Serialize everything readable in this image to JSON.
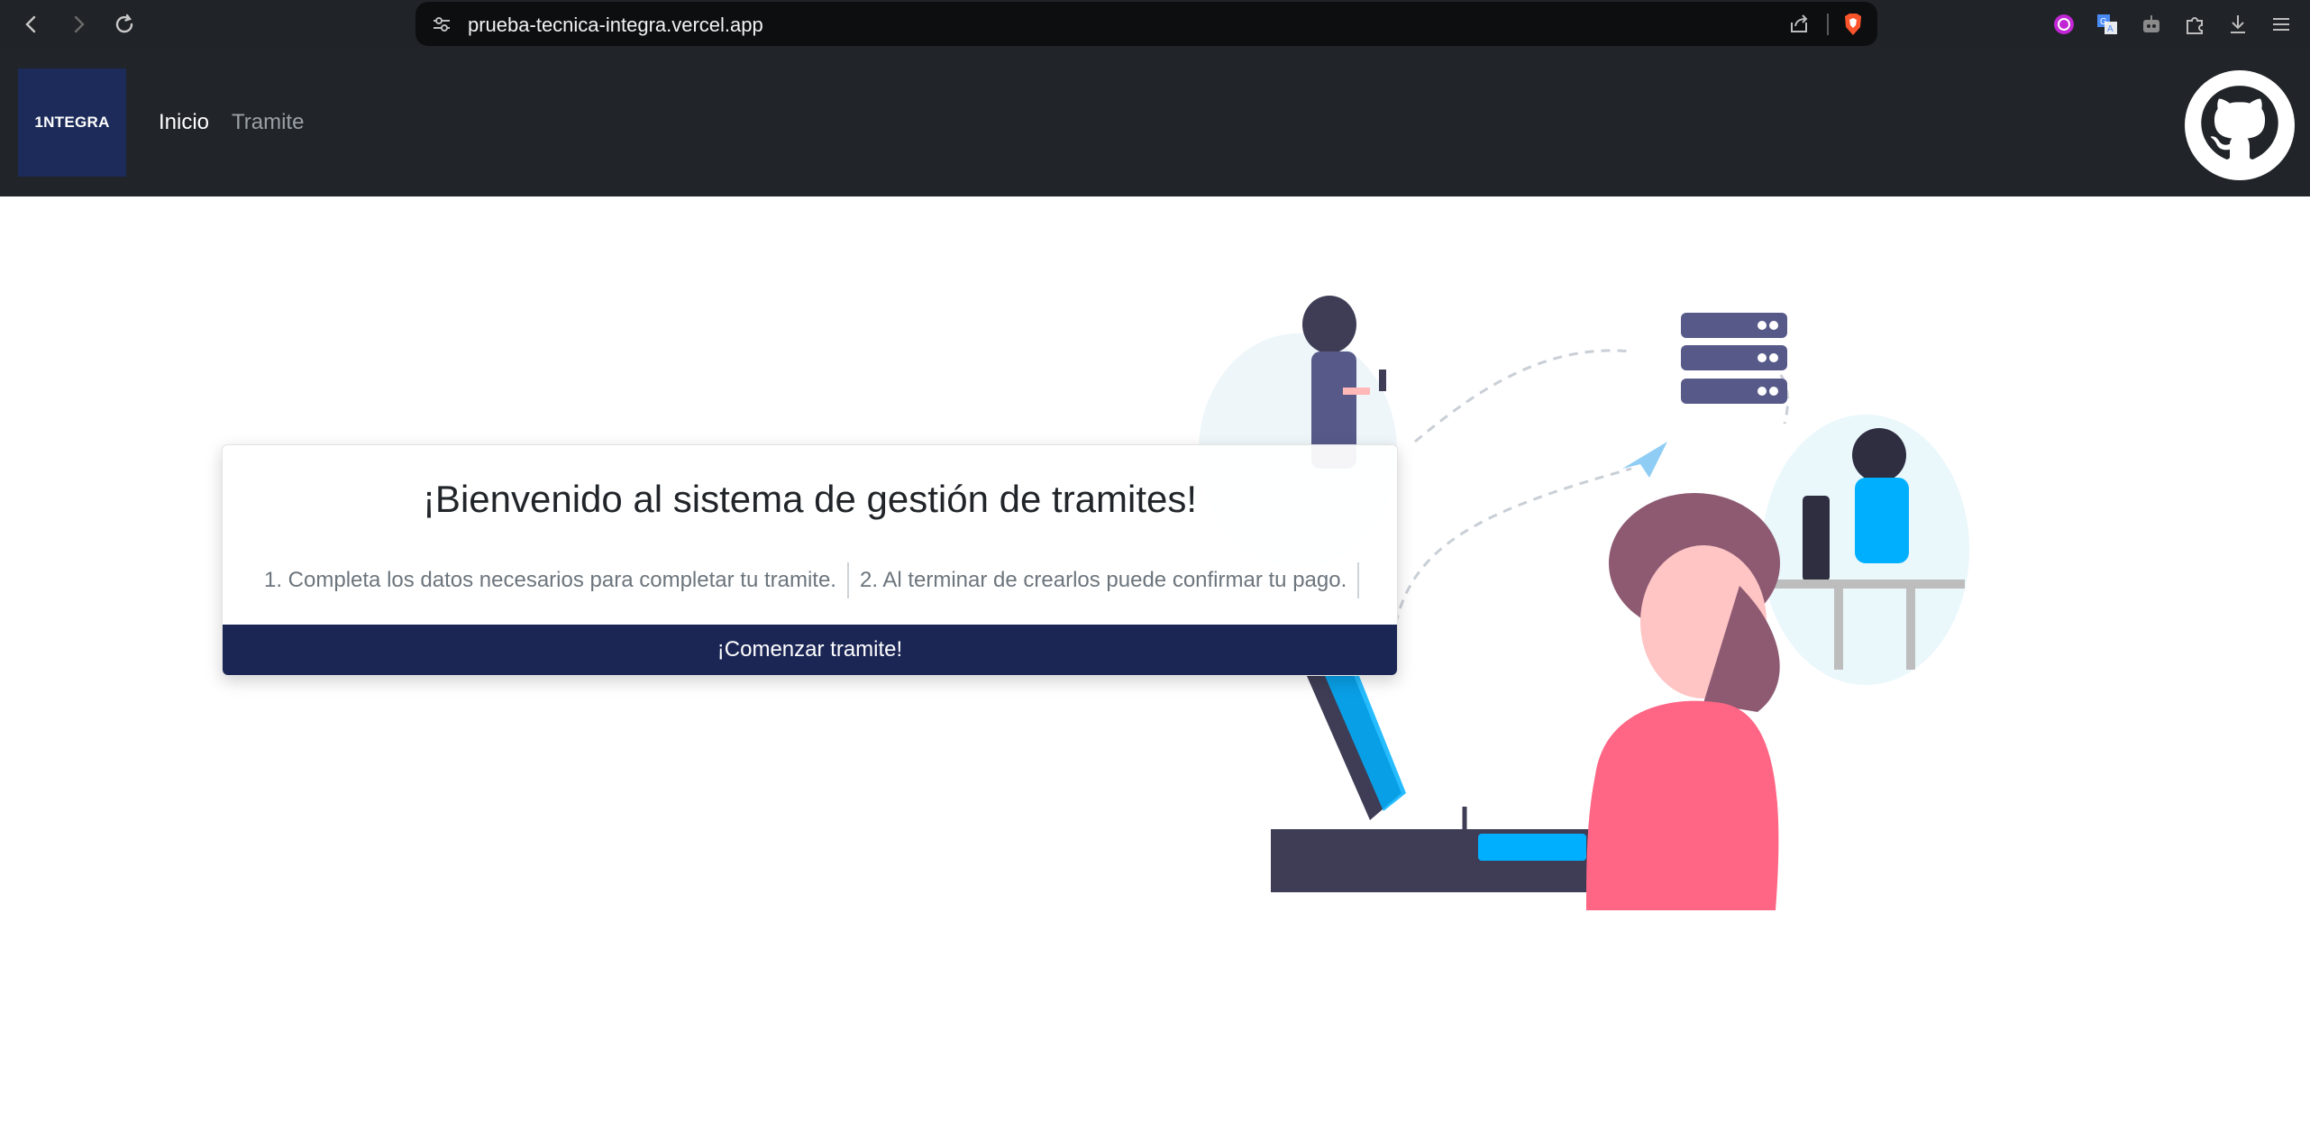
{
  "browser": {
    "url": "prueba-tecnica-integra.vercel.app"
  },
  "navbar": {
    "logo_text": "1NTEGRA",
    "links": [
      {
        "label": "Inicio",
        "active": true
      },
      {
        "label": "Tramite",
        "active": false
      }
    ]
  },
  "welcome": {
    "title": "¡Bienvenido al sistema de gestión de tramites!",
    "steps": [
      "1. Completa los datos necesarios para completar tu tramite.",
      "2. Al terminar de crearlos puede confirmar tu pago."
    ],
    "button_label": "¡Comenzar tramite!"
  },
  "colors": {
    "navbar_bg": "#212529",
    "logo_bg": "#1c2b5a",
    "button_bg": "#1c2655",
    "illustration_pink": "#ff6584",
    "illustration_purple": "#575a89",
    "illustration_blue": "#00b0ff"
  }
}
